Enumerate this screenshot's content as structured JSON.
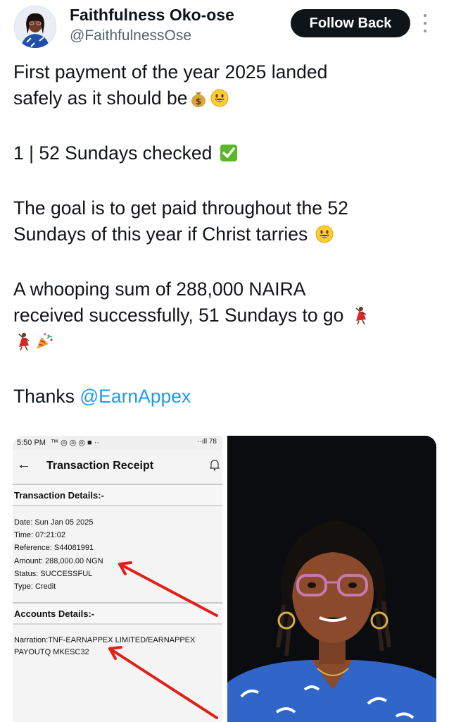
{
  "author": {
    "display_name": "Faithfulness Oko-ose",
    "handle": "@FaithfulnessOse",
    "follow_label": "Follow Back"
  },
  "tweet": {
    "line1": "First payment of the year 2025 landed",
    "line2": "safely as it should be",
    "line3": " 1 | 52 Sundays checked ",
    "line4": "The goal is to get paid throughout the 52",
    "line5": "Sundays of this year if Christ tarries ",
    "line6": "A whooping sum of 288,000 NAIRA",
    "line7": "received successfully, 51 Sundays to go ",
    "thanks": " Thanks ",
    "mention": "@EarnAppex"
  },
  "icons": {
    "avatar": "profile-photo",
    "more": "vertical-dots-icon",
    "money_bag": "money-bag-emoji",
    "smiley": "grinning-face-emoji",
    "check": "check-mark-button-emoji",
    "dancer": "woman-dancing-emoji",
    "party": "party-popper-emoji"
  },
  "receipt": {
    "status_time": "5:50 PM",
    "status_icons": "™ ◎ ◎ ◎ ■ ··",
    "status_right": "··ıll 78",
    "title": "Transaction Receipt",
    "section1": "Transaction Details:-",
    "date": "Date: Sun Jan 05 2025",
    "time": "Time: 07:21:02",
    "reference": "Reference: S44081991",
    "amount": "Amount: 288,000.00 NGN",
    "status": "Status: SUCCESSFUL",
    "type": "Type: Credit",
    "section2": "Accounts Details:-",
    "narration": "Narration:TNF-EARNAPPEX LIMITED/EARNAPPEX PAYOUTQ MKESC32"
  },
  "colors": {
    "link": "#1d9bf0",
    "button_bg": "#0f1419",
    "arrow_red": "#e0201b"
  }
}
